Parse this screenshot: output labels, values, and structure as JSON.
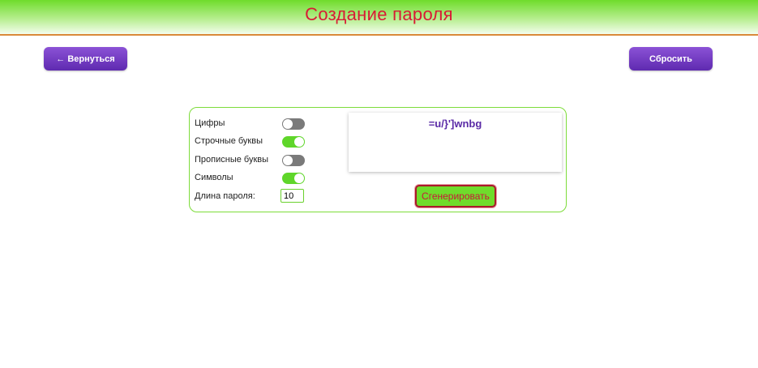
{
  "header": {
    "title": "Создание пароля"
  },
  "toolbar": {
    "back_label": "← Вернуться",
    "reset_label": "Сбросить"
  },
  "options": [
    {
      "label": "Цифры",
      "enabled": false
    },
    {
      "label": "Строчные буквы",
      "enabled": true
    },
    {
      "label": "Прописные буквы",
      "enabled": false
    },
    {
      "label": "Символы",
      "enabled": true
    }
  ],
  "length": {
    "label": "Длина пароля:",
    "value": "10"
  },
  "output": {
    "password": "=u/}']wnbg"
  },
  "generate": {
    "label": "Сгенерировать"
  },
  "colors": {
    "accent_purple": "#6a35c0",
    "accent_green": "#6fdc2b",
    "title_red": "#d81b35"
  }
}
